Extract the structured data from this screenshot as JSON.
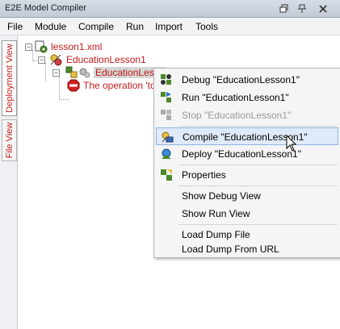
{
  "window": {
    "title": "E2E Model Compiler"
  },
  "titlebar_buttons": [
    "restore-icon",
    "pin-icon",
    "close-icon"
  ],
  "menubar": {
    "items": [
      "File",
      "Module",
      "Compile",
      "Run",
      "Import",
      "Tools"
    ]
  },
  "side_tabs": [
    {
      "label": "Deployment View",
      "active": true
    },
    {
      "label": "File View",
      "active": false
    }
  ],
  "tree": {
    "nodes": [
      {
        "label": "lesson1.xml",
        "icon": "file-gear-icon",
        "expanded": true
      },
      {
        "label": "EducationLesson1",
        "icon": "model-icon",
        "expanded": true
      },
      {
        "label": "EducationLesso",
        "icon": "component-icon",
        "selected": true
      },
      {
        "label": "The operation 'tou",
        "icon": "stop-icon"
      }
    ]
  },
  "context_menu": {
    "items": [
      {
        "label": "Debug \"EducationLesson1\"",
        "icon": "debug-icon",
        "enabled": true
      },
      {
        "label": "Run \"EducationLesson1\"",
        "icon": "run-icon",
        "enabled": true
      },
      {
        "label": "Stop \"EducationLesson1\"",
        "icon": "stop-gear-icon",
        "enabled": false
      },
      {
        "label": "Compile \"EducationLesson1\"",
        "icon": "compile-icon",
        "enabled": true,
        "highlighted": true
      },
      {
        "label": "Deploy \"EducationLesson1\"",
        "icon": "deploy-icon",
        "enabled": true
      },
      {
        "label": "Properties",
        "icon": "properties-icon",
        "enabled": true
      },
      {
        "label": "Show Debug View",
        "enabled": true
      },
      {
        "label": "Show Run View",
        "enabled": true
      },
      {
        "label": "Load Dump File",
        "enabled": true
      },
      {
        "label": "Load Dump From URL",
        "enabled": true
      }
    ]
  },
  "colors": {
    "tree_text": "#c21a1a",
    "highlight_bg": "#dfeaf8",
    "highlight_border": "#8db2e3",
    "disabled_text": "#9a9a9a"
  }
}
